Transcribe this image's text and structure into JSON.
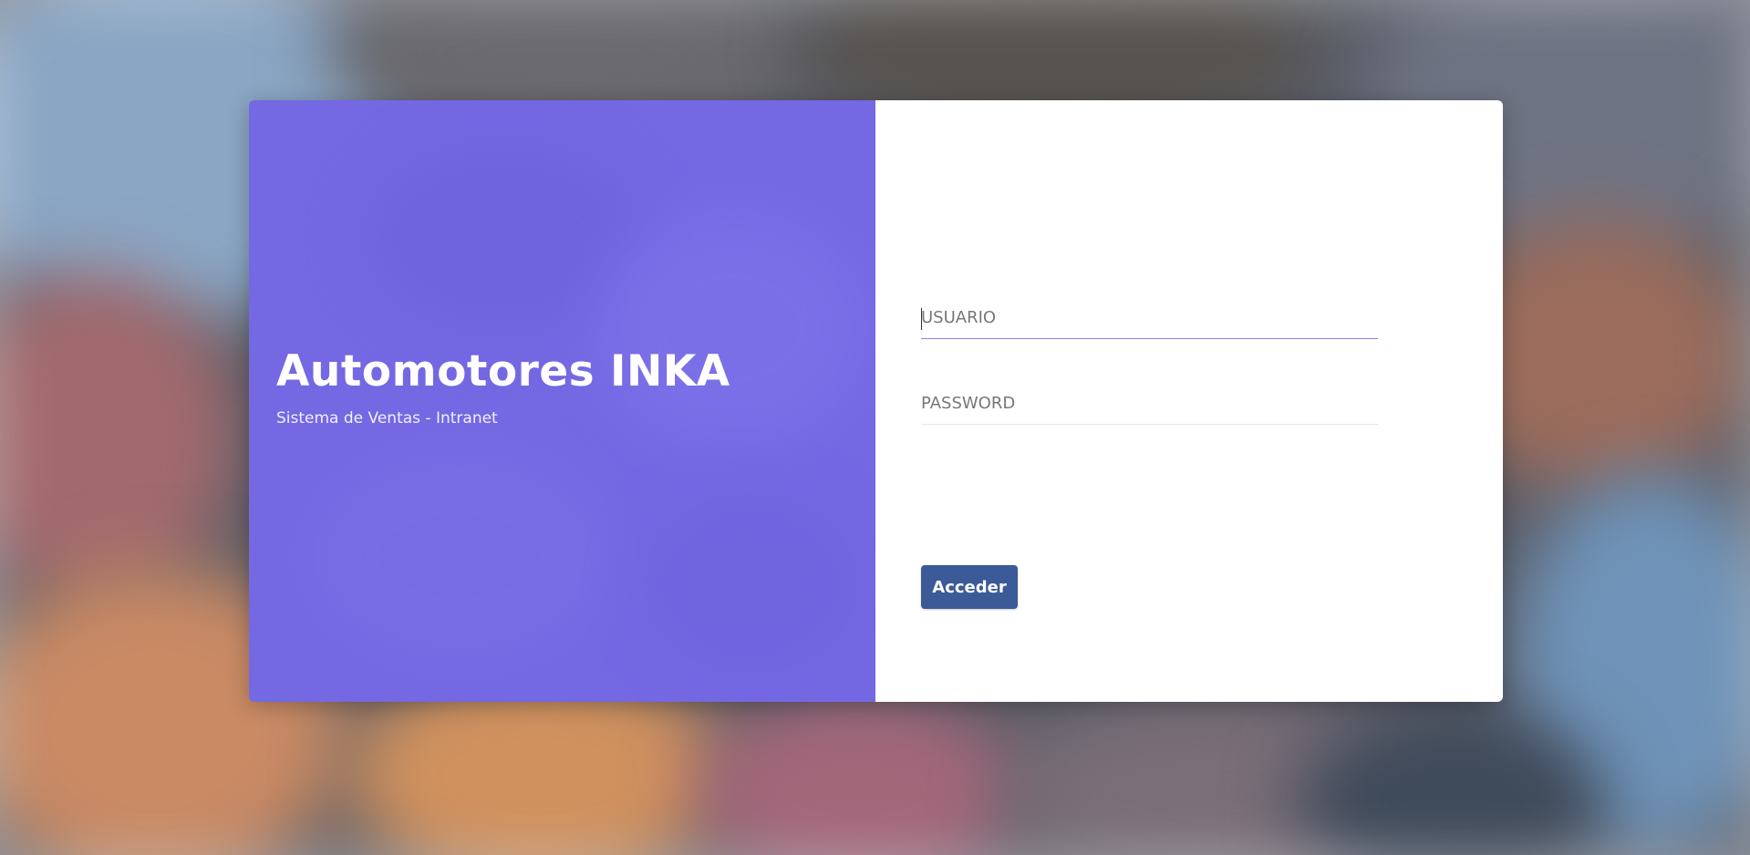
{
  "brand": {
    "title": "Automotores INKA",
    "subtitle": "Sistema de Ventas - Intranet"
  },
  "login_form": {
    "username_placeholder": "USUARIO",
    "username_value": "",
    "password_placeholder": "PASSWORD",
    "password_value": "",
    "submit_label": "Acceder"
  },
  "colors": {
    "left_panel": "#7468e3",
    "button": "#3b5a97",
    "active_underline": "#8b80ee"
  }
}
